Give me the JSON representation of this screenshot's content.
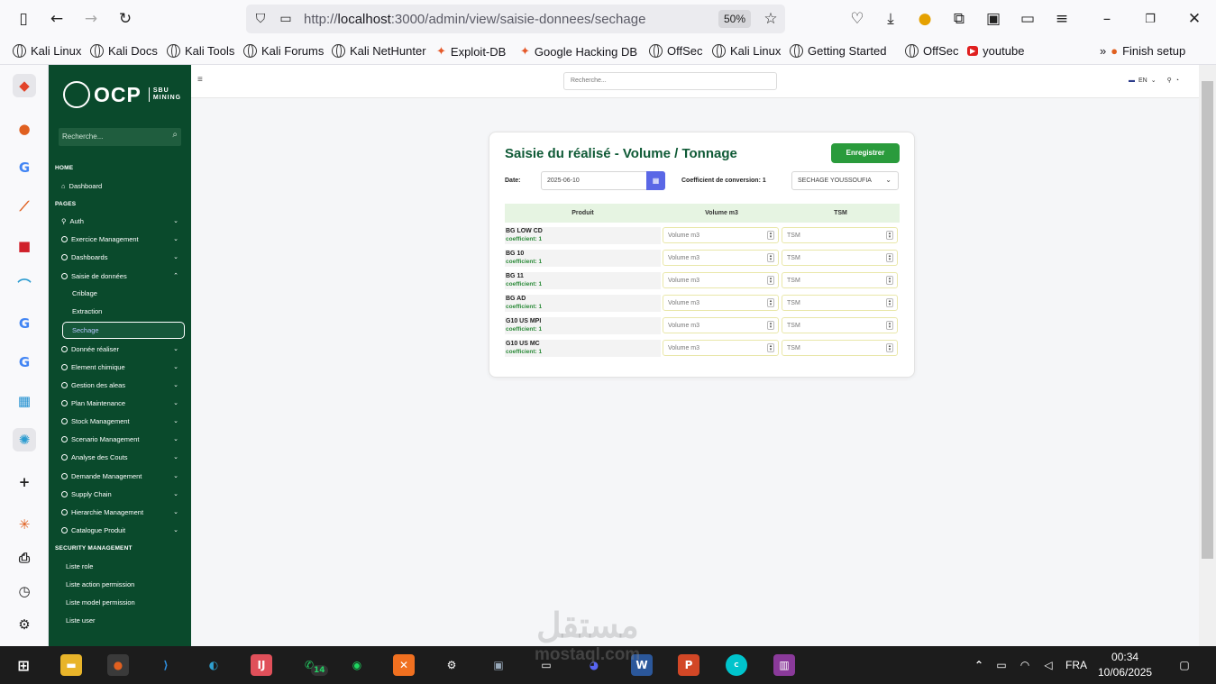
{
  "browser": {
    "url_prefix": "http://",
    "url_host": "localhost",
    "url_path": ":3000/admin/view/saisie-donnees/sechage",
    "zoom": "50%",
    "bookmarks": [
      "Kali Linux",
      "Kali Docs",
      "Kali Tools",
      "Kali Forums",
      "Kali NetHunter",
      "Exploit-DB",
      "Google Hacking DB",
      "OffSec",
      "Kali Linux",
      "Getting Started",
      "OffSec",
      "youtube",
      "Finish setup"
    ]
  },
  "sidebar": {
    "logo_text": "OCP",
    "logo_sub1": "SBU",
    "logo_sub2": "MINING",
    "search_placeholder": "Recherche...",
    "section_home": "HOME",
    "dashboard": "Dashboard",
    "section_pages": "PAGES",
    "items": [
      "Auth",
      "Exercice Management",
      "Dashboards",
      "Saisie de données"
    ],
    "sub_items": [
      "Criblage",
      "Extraction",
      "Sechage"
    ],
    "items2": [
      "Donnée réaliser",
      "Element chimique",
      "Gestion des aleas",
      "Plan Maintenance",
      "Stock Management",
      "Scenario Management",
      "Analyse des Couts",
      "Demande Management",
      "Supply Chain",
      "Hierarchie Management",
      "Catalogue Produit"
    ],
    "section_security": "SECURITY MANAGEMENT",
    "security_items": [
      "Liste role",
      "Liste action permission",
      "Liste model permission",
      "Liste user"
    ]
  },
  "topbar": {
    "search_placeholder": "Recherche...",
    "lang": "EN"
  },
  "form": {
    "title": "Saisie du réalisé - Volume / Tonnage",
    "save_label": "Enregistrer",
    "date_label": "Date:",
    "date_value": "2025-06-10",
    "coef_label": "Coefficient de conversion: 1",
    "site_value": "SECHAGE YOUSSOUFIA",
    "col_product": "Produit",
    "col_volume": "Volume m3",
    "col_tsm": "TSM",
    "volume_placeholder": "Volume m3",
    "tsm_placeholder": "TSM",
    "rows": [
      {
        "name": "BG LOW CD",
        "coef": "coefficient: 1"
      },
      {
        "name": "BG 10",
        "coef": "coefficient: 1"
      },
      {
        "name": "BG 11",
        "coef": "coefficient: 1"
      },
      {
        "name": "BG AD",
        "coef": "coefficient: 1"
      },
      {
        "name": "G10 US MPI",
        "coef": "coefficient: 1"
      },
      {
        "name": "G10 US MC",
        "coef": "coefficient: 1"
      }
    ]
  },
  "taskbar": {
    "lang": "FRA",
    "time": "00:34",
    "date": "10/06/2025",
    "whatsapp_badge": "14"
  },
  "watermark": {
    "arabic": "مستقل",
    "latin": "mostaql.com"
  },
  "colors": {
    "sidebar": "#0a4a2c",
    "accent": "#2a9b3c",
    "title": "#0f5a36",
    "date_button": "#5a67e6"
  }
}
